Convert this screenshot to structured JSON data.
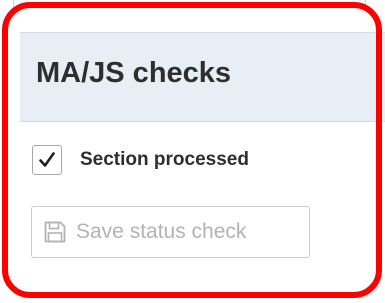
{
  "panel": {
    "title": "MA/JS checks"
  },
  "section_processed": {
    "label": "Section processed",
    "checked": true
  },
  "save_button": {
    "label": "Save status check",
    "icon": "floppy-disk-icon",
    "enabled": false
  },
  "colors": {
    "highlight": "#ff0000",
    "header_background": "#e8eef6",
    "disabled_text": "#b3b3b3"
  }
}
